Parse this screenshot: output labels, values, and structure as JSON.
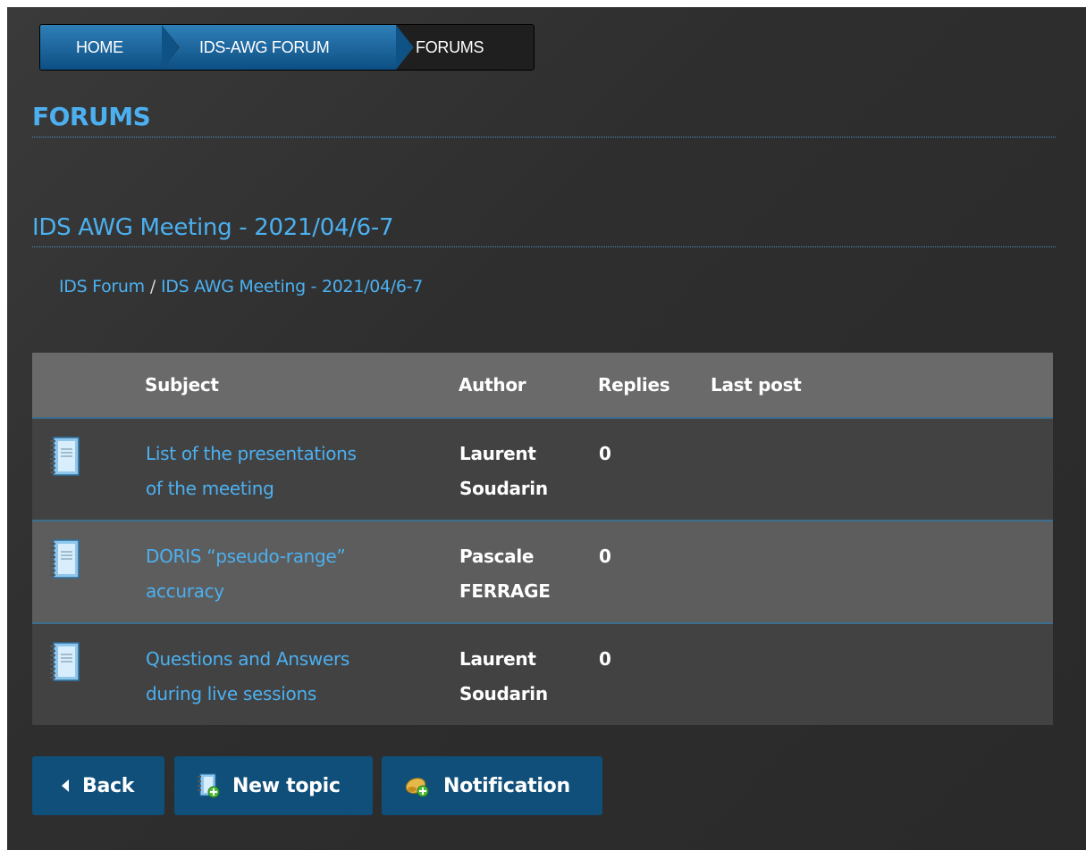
{
  "breadcrumb": {
    "items": [
      "HOME",
      "IDS-AWG FORUM",
      "FORUMS"
    ]
  },
  "page_title": "FORUMS",
  "forum_title": "IDS AWG Meeting - 2021/04/6-7",
  "path": {
    "items": [
      "IDS Forum",
      "IDS AWG Meeting - 2021/04/6-7"
    ],
    "separator": "/"
  },
  "table": {
    "headers": [
      "Subject",
      "Author",
      "Replies",
      "Last post"
    ],
    "rows": [
      {
        "subject_line1": "List of the presentations",
        "subject_line2": "of the meeting",
        "author_line1": "Laurent",
        "author_line2": "Soudarin",
        "replies": "0",
        "last_post": ""
      },
      {
        "subject_line1": "DORIS “pseudo-range”",
        "subject_line2": "accuracy",
        "author_line1": "Pascale",
        "author_line2": "FERRAGE",
        "replies": "0",
        "last_post": ""
      },
      {
        "subject_line1": "Questions and Answers",
        "subject_line2": "during live sessions",
        "author_line1": "Laurent",
        "author_line2": "Soudarin",
        "replies": "0",
        "last_post": ""
      }
    ]
  },
  "buttons": {
    "back": "Back",
    "new_topic": "New topic",
    "notification": "Notification"
  },
  "colors": {
    "accent": "#4cb0f0",
    "button_bg": "#0f4f79",
    "header_bg": "#6a6a6a"
  },
  "icons": {
    "topic": "notebook-icon",
    "back": "triangle-left-icon",
    "new_topic": "new-topic-icon",
    "notification": "bell-plus-icon"
  }
}
